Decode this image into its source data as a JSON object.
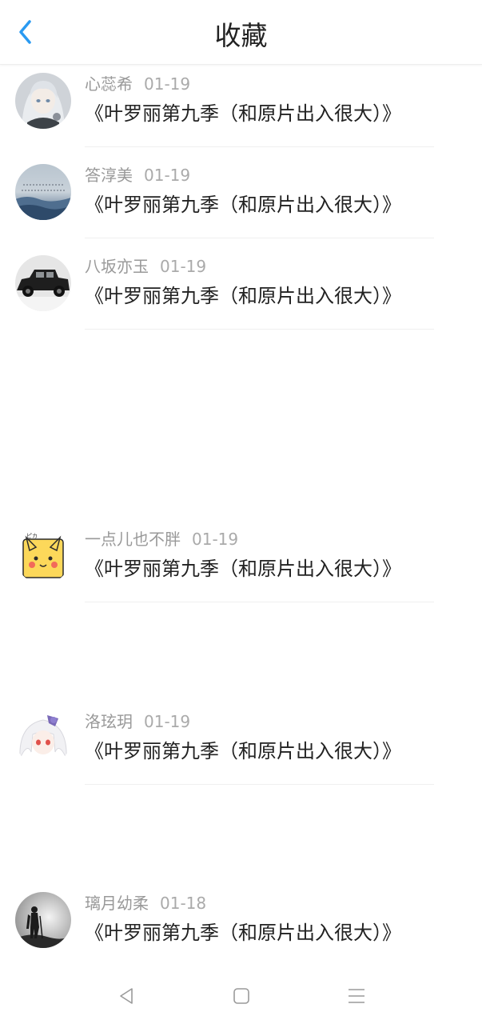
{
  "header": {
    "title": "收藏",
    "back_icon": "chevron-left-icon",
    "accent_color": "#2a9af1"
  },
  "items": [
    {
      "user": "心蕊希",
      "date": "01-19",
      "title": "《叶罗丽第九季（和原片出入很大）》",
      "avatar": "anime-girl-silver-hair"
    },
    {
      "user": "答淳美",
      "date": "01-19",
      "title": "《叶罗丽第九季（和原片出入很大）》",
      "avatar": "sea-landscape"
    },
    {
      "user": "八坂亦玉",
      "date": "01-19",
      "title": "《叶罗丽第九季（和原片出入很大）》",
      "avatar": "black-car"
    },
    {
      "user": "一点儿也不胖",
      "date": "01-19",
      "title": "《叶罗丽第九季（和原片出入很大）》",
      "avatar": "pikachu"
    },
    {
      "user": "洛玹玥",
      "date": "01-19",
      "title": "《叶罗丽第九季（和原片出入很大）》",
      "avatar": "anime-girl-white-hair"
    },
    {
      "user": "璃月幼柔",
      "date": "01-18",
      "title": "《叶罗丽第九季（和原片出入很大）》",
      "avatar": "hiker-silhouette"
    }
  ],
  "navbar": {
    "back_icon": "triangle-back-icon",
    "home_icon": "square-home-icon",
    "menu_icon": "menu-lines-icon"
  }
}
